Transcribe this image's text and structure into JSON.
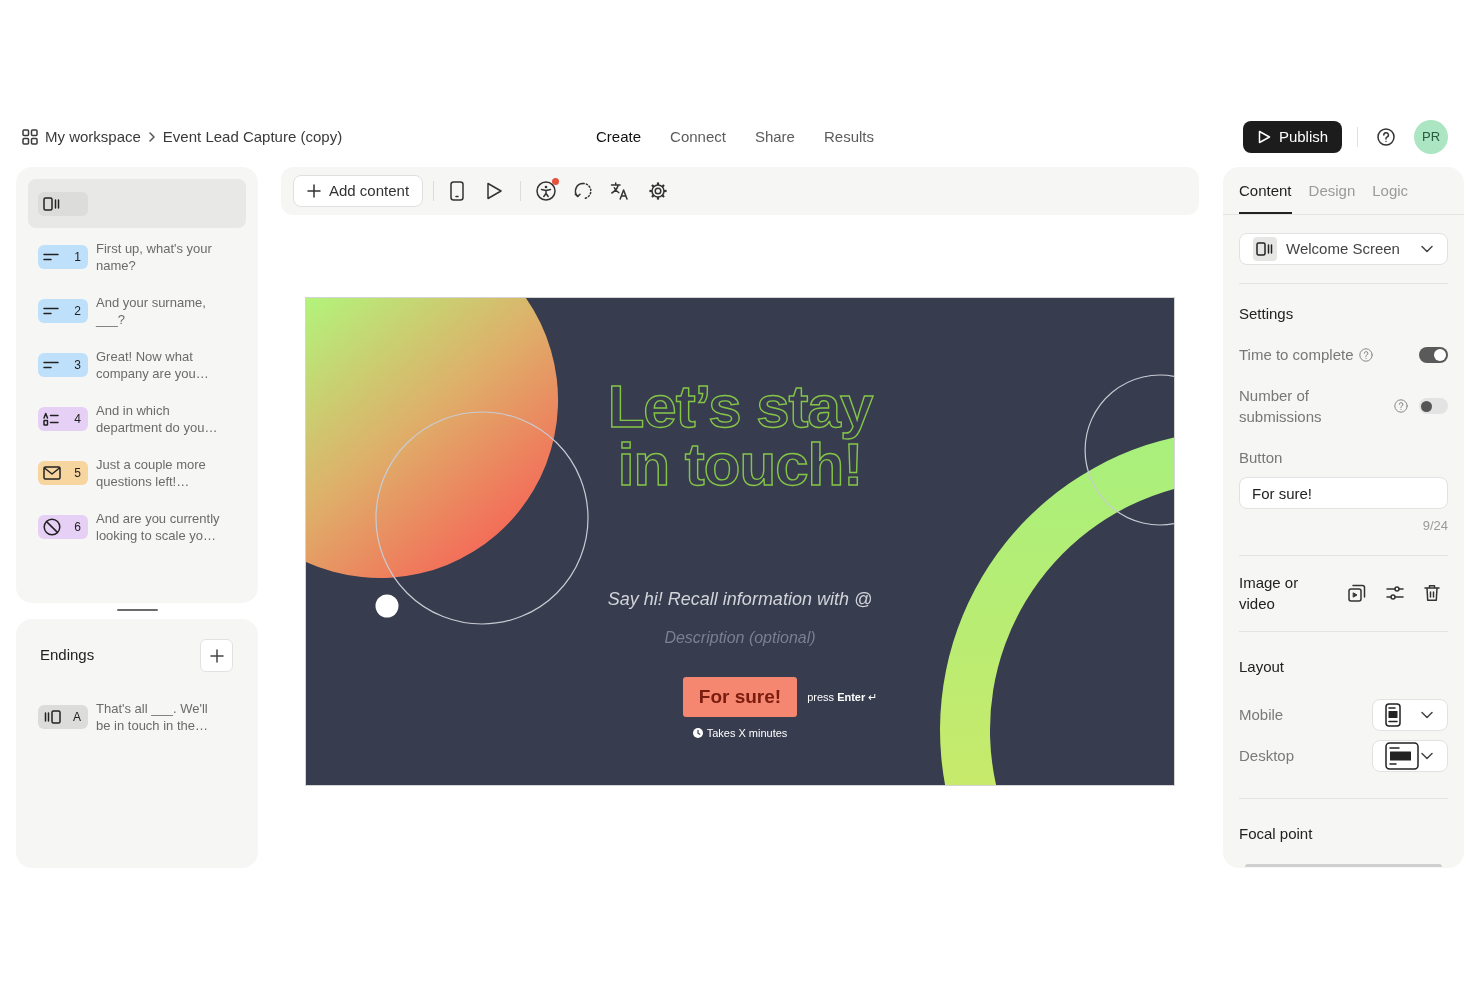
{
  "header": {
    "breadcrumb": [
      {
        "label": "My workspace"
      },
      {
        "label": "Event Lead Capture (copy)"
      }
    ],
    "nav": [
      {
        "label": "Create",
        "selected": true
      },
      {
        "label": "Connect",
        "selected": false
      },
      {
        "label": "Share",
        "selected": false
      },
      {
        "label": "Results",
        "selected": false
      }
    ],
    "publish_button": "Publish",
    "avatar": "PR"
  },
  "toolbar": {
    "add_content_button": "Add content",
    "accessibility_alert": true
  },
  "sidebar": {
    "welcome": {
      "selected": true
    },
    "questions": [
      {
        "kind": "text",
        "number": "1",
        "title": "First up, what's your name?",
        "color": "#bfe0fa",
        "selected": false
      },
      {
        "kind": "text",
        "number": "2",
        "title": "And your surname, ___?",
        "color": "#bfe0fa",
        "selected": false
      },
      {
        "kind": "text",
        "number": "3",
        "title": "Great! Now what company are you…",
        "color": "#bfe0fa",
        "selected": false
      },
      {
        "kind": "choice",
        "number": "4",
        "title": "And in which department do you…",
        "color": "#e6d0f5",
        "selected": false
      },
      {
        "kind": "email",
        "number": "5",
        "title": "Just a couple more questions left!…",
        "color": "#f6d59f",
        "selected": false
      },
      {
        "kind": "block",
        "number": "6",
        "title": "And are you currently looking to scale yo…",
        "color": "#e6d0f5",
        "selected": false
      }
    ],
    "endings": {
      "title": "Endings",
      "items": [
        {
          "letter": "A",
          "title": "That's all ___. We'll be in touch in the…",
          "selected": false
        }
      ]
    }
  },
  "canvas": {
    "title": "Let’s stay in touch!",
    "subtitle": "Say hi! Recall information with @",
    "description": {
      "placeholder": "Description (optional)"
    },
    "button": "For sure!",
    "key_hint": "press **Enter** ↵",
    "time_note": "Takes X minutes"
  },
  "panel": {
    "tabs": [
      {
        "label": "Content",
        "selected": true
      },
      {
        "label": "Design",
        "selected": false
      },
      {
        "label": "Logic",
        "selected": false
      }
    ],
    "screen_select": "Welcome Screen",
    "settings": {
      "title": "Settings",
      "toggles": [
        {
          "label": "Time to complete",
          "on": true
        },
        {
          "label": "Number of submissions",
          "on": false
        }
      ]
    },
    "button_field": {
      "label": "Button",
      "value": "For sure!",
      "counter": "9/24"
    },
    "media": {
      "label": "Image or video"
    },
    "layout": {
      "title": "Layout",
      "rows": [
        {
          "kind": "mobile",
          "label": "Mobile"
        },
        {
          "kind": "desktop",
          "label": "Desktop"
        }
      ]
    },
    "focal_point": {
      "label": "Focal point"
    }
  }
}
